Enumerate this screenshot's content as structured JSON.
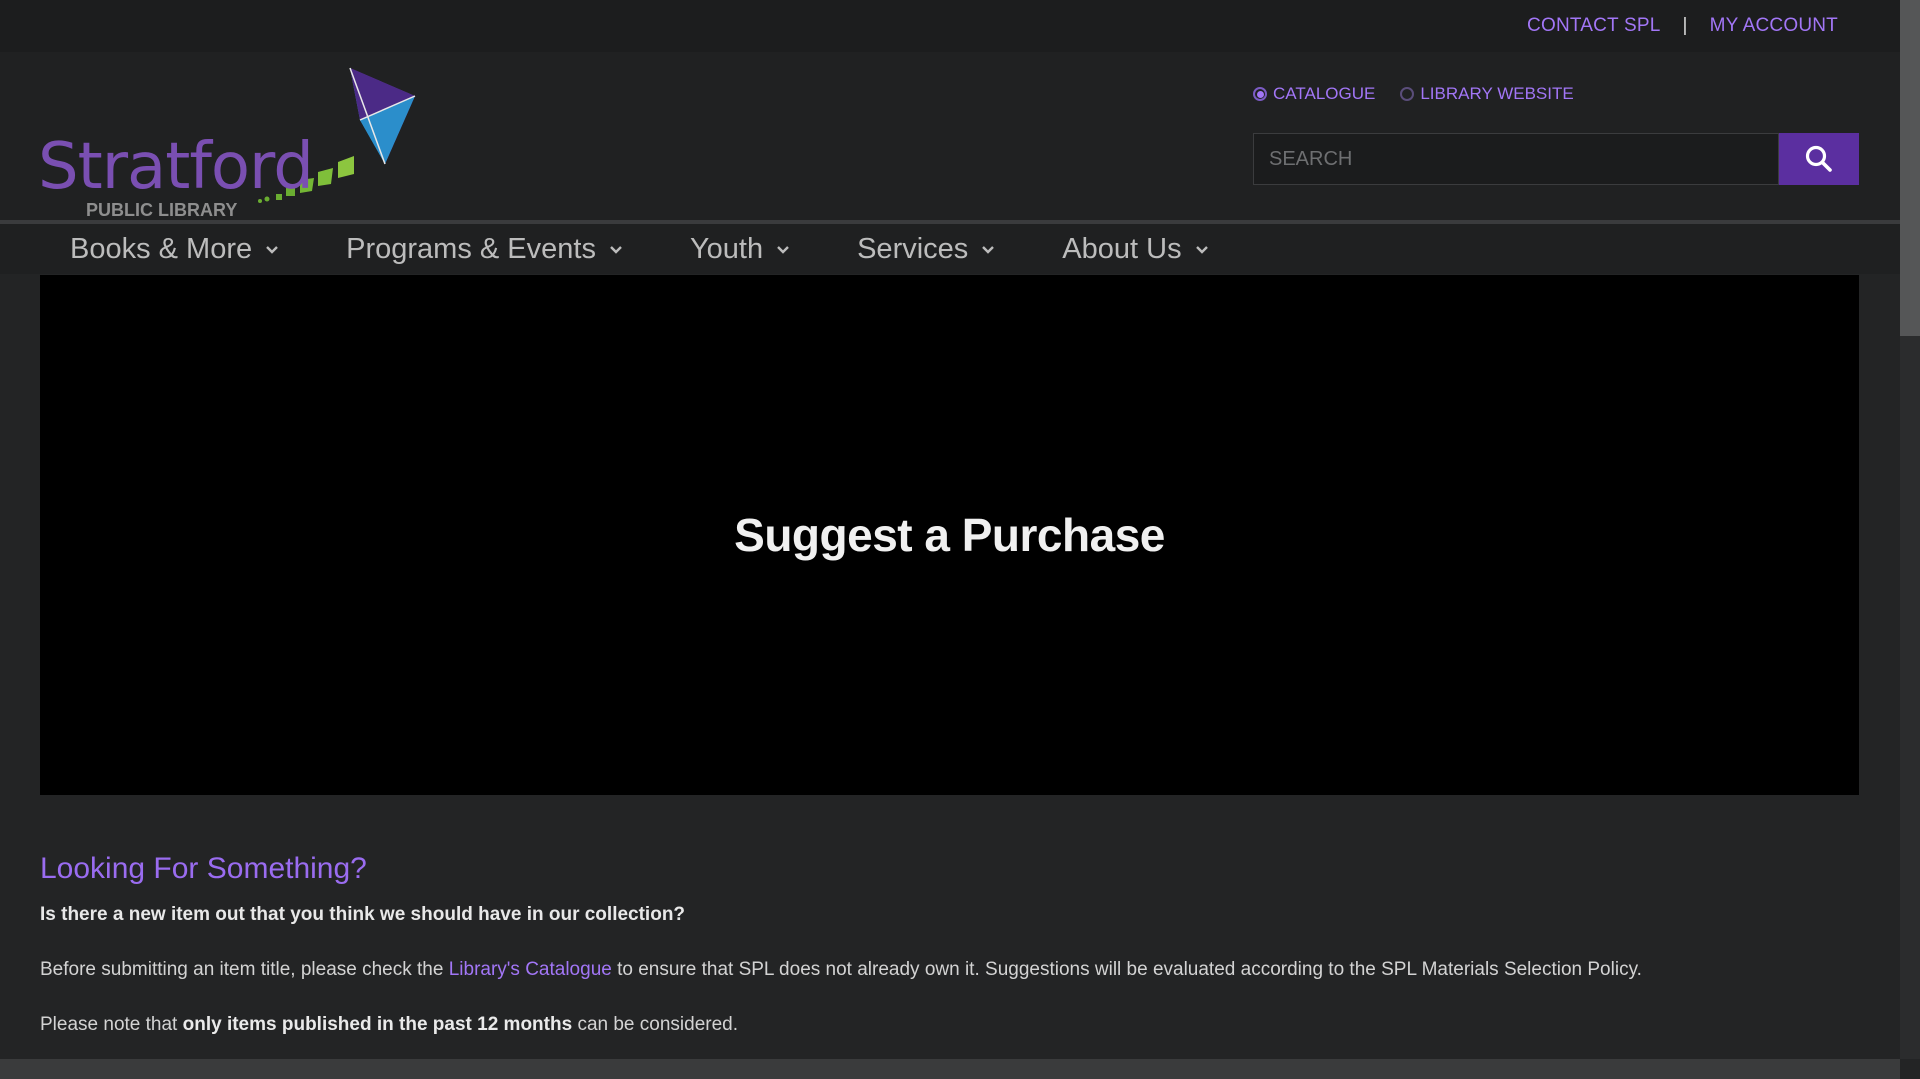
{
  "top_links": {
    "contact": "CONTACT SPL",
    "separator": "|",
    "account": "MY ACCOUNT"
  },
  "logo": {
    "name": "Stratford",
    "subtitle": "PUBLIC LIBRARY"
  },
  "search": {
    "options": [
      {
        "label": "CATALOGUE",
        "selected": true
      },
      {
        "label": "LIBRARY WEBSITE",
        "selected": false
      }
    ],
    "placeholder": "SEARCH",
    "button_icon": "search-icon"
  },
  "nav": {
    "items": [
      {
        "label": "Books & More"
      },
      {
        "label": "Programs & Events"
      },
      {
        "label": "Youth"
      },
      {
        "label": "Services"
      },
      {
        "label": "About Us"
      }
    ]
  },
  "hero": {
    "title": "Suggest a Purchase"
  },
  "content": {
    "heading": "Looking For Something?",
    "question": "Is there a new item out that you think we should have in our collection?",
    "para1_before": "Before submitting an item title, please check the ",
    "para1_link": "Library's Catalogue",
    "para1_after": " to ensure that SPL does not already own it. Suggestions will be evaluated according to the SPL Materials Selection Policy.",
    "para2_before": "Please note that ",
    "para2_bold": "only items published in the past 12 months",
    "para2_after": " can be considered."
  },
  "colors": {
    "accent": "#a276f6",
    "search_button": "#5b2fa0",
    "background": "#232425",
    "hero_background": "#000000"
  }
}
